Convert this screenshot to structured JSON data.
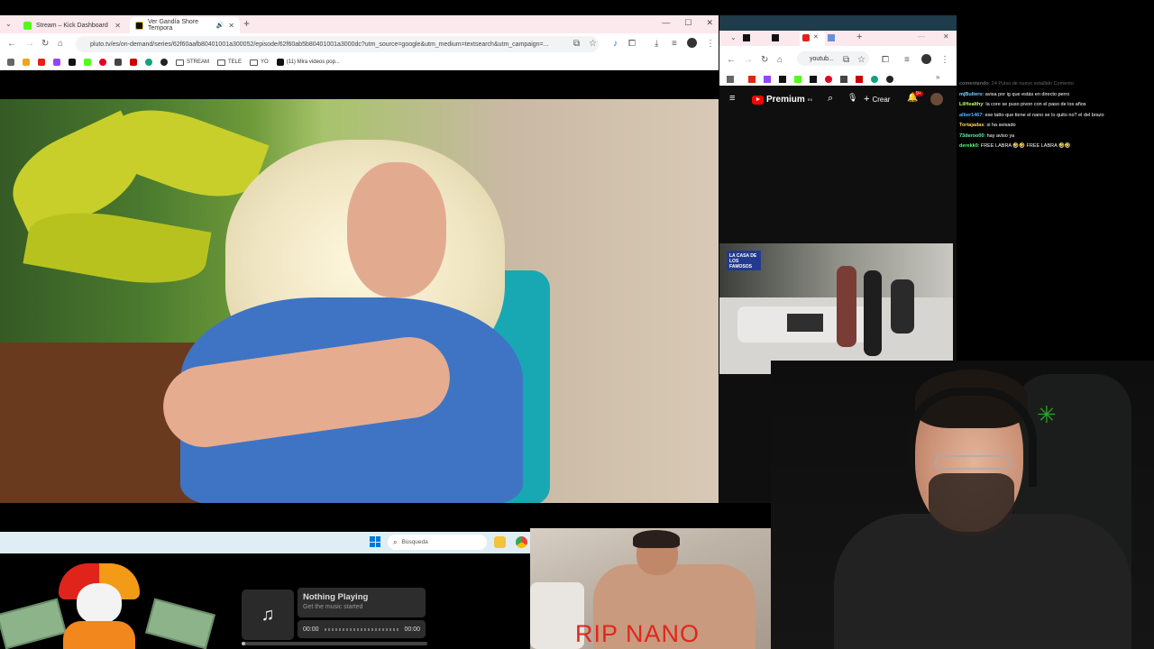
{
  "left_browser": {
    "tabs": [
      {
        "label": "Stream – Kick Dashboard",
        "active": false,
        "favicon_color": "#53fc18"
      },
      {
        "label": "Ver Gandía Shore Tempora",
        "active": true,
        "favicon_color": "#111111"
      }
    ],
    "url": "pluto.tv/es/on-demand/series/62f60aafb80401001a300052/episode/62f60ab5b80401001a3000dc?utm_source=google&utm_medium=textsearch&utm_campaign=...",
    "bookmarks": [
      "STREAM",
      "TELE",
      "YO",
      "(11) Mira videos pop..."
    ]
  },
  "right_browser": {
    "url": "youtub...",
    "logo": "Premium",
    "premium_sup": "ES",
    "create_label": "Crear",
    "notif_count": "9+",
    "video_logo": "LA CASA DE LOS FAMOSOS"
  },
  "chat": [
    {
      "user": "comentando",
      "text": ": 24 Pulso de nuevo estallido Comento",
      "color": "#666666",
      "faded": true
    },
    {
      "user": "mjBultero",
      "text": ": avisa por ig que estás en directo perro",
      "color": "#7ad4ff"
    },
    {
      "user": "LilHealthy",
      "text": ": la core se puso pivon con el paso de los años",
      "color": "#c6ff6b"
    },
    {
      "user": "alber1467",
      "text": ": ese tatto que tiene el nano se lo quito no? el del brazo",
      "color": "#55b6ff"
    },
    {
      "user": "Tortajadas",
      "text": ": si ha avisado",
      "color": "#ffd45b"
    },
    {
      "user": "73deroo00",
      "text": ": hay aviso ya",
      "color": "#6bf0b2"
    },
    {
      "user": "derekk0",
      "text": ": FREE LABRA 🤣🤣 FREE LABRA 🤣🤣",
      "color": "#5cff7a"
    }
  ],
  "taskbar": {
    "search_placeholder": "Búsqueda"
  },
  "now_playing": {
    "title": "Nothing Playing",
    "subtitle": "Get the music started",
    "time_start": "00:00",
    "time_end": "00:00",
    "progress": 0.02
  },
  "overlay": {
    "rip_text": "RIP NANO"
  },
  "icons": {
    "music": "♫",
    "search": "⌕",
    "razer": "🜲"
  }
}
